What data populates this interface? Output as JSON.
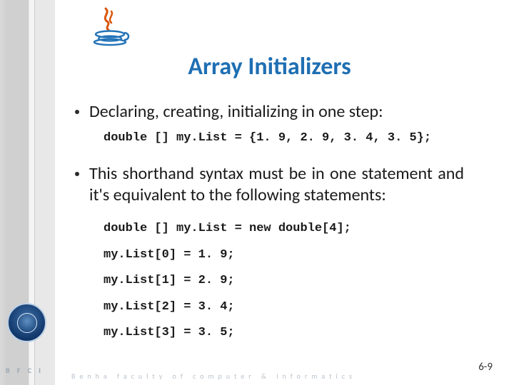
{
  "slide": {
    "title": "Array Initializers",
    "bullets": [
      "Declaring, creating, initializing in one step:",
      "This shorthand syntax must be in one statement and it's equivalent to the following statements:"
    ],
    "code1": "double [] my.List = {1. 9, 2. 9, 3. 4, 3. 5};",
    "code2": "double [] my.List = new double[4];\nmy.List[0] = 1. 9;\nmy.List[1] = 2. 9;\nmy.List[2] = 3. 4;\nmy.List[3] = 3. 5;"
  },
  "footer": {
    "bfci": "B F C I",
    "tagline": "Benha faculty of computer & Informatics",
    "page": "6-9"
  },
  "logo": {
    "name": "java-logo"
  }
}
